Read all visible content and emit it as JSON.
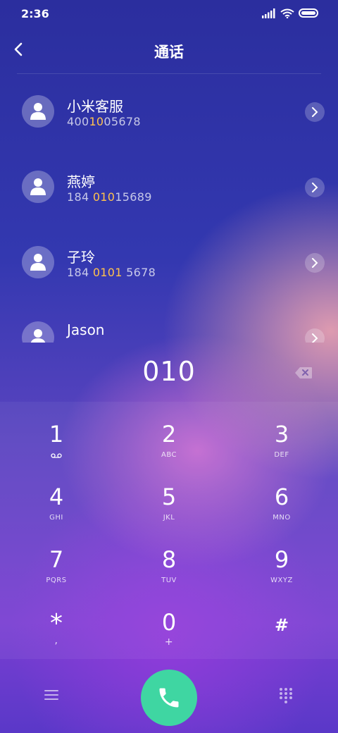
{
  "status_bar": {
    "time": "2:36"
  },
  "header": {
    "title": "通话"
  },
  "contacts": [
    {
      "name": "小米客服",
      "number_pre": "400",
      "number_match": "10",
      "number_post": "05678"
    },
    {
      "name": "燕婷",
      "number_pre": "184 ",
      "number_match": "010",
      "number_post": "15689"
    },
    {
      "name": "子玲",
      "number_pre": "184 ",
      "number_match": "0101",
      "number_post": " 5678"
    },
    {
      "name": "Jason",
      "number_pre": "",
      "number_match": "",
      "number_post": ""
    }
  ],
  "dial_input": "010",
  "keypad": [
    {
      "digit": "1",
      "sub": ""
    },
    {
      "digit": "2",
      "sub": "ABC"
    },
    {
      "digit": "3",
      "sub": "DEF"
    },
    {
      "digit": "4",
      "sub": "GHI"
    },
    {
      "digit": "5",
      "sub": "JKL"
    },
    {
      "digit": "6",
      "sub": "MNO"
    },
    {
      "digit": "7",
      "sub": "PQRS"
    },
    {
      "digit": "8",
      "sub": "TUV"
    },
    {
      "digit": "9",
      "sub": "WXYZ"
    },
    {
      "digit": "*",
      "sub": ","
    },
    {
      "digit": "0",
      "sub": "+"
    },
    {
      "digit": "#",
      "sub": ""
    }
  ],
  "icons": {
    "back": "chevron-left-icon",
    "delete": "backspace-icon",
    "voicemail": "voicemail-icon",
    "menu": "menu-icon",
    "call": "phone-icon",
    "keypad": "keypad-icon",
    "avatar": "person-icon",
    "go": "chevron-right-icon"
  },
  "colors": {
    "highlight": "#ffc24d",
    "call_button": "#3fd6a2"
  }
}
